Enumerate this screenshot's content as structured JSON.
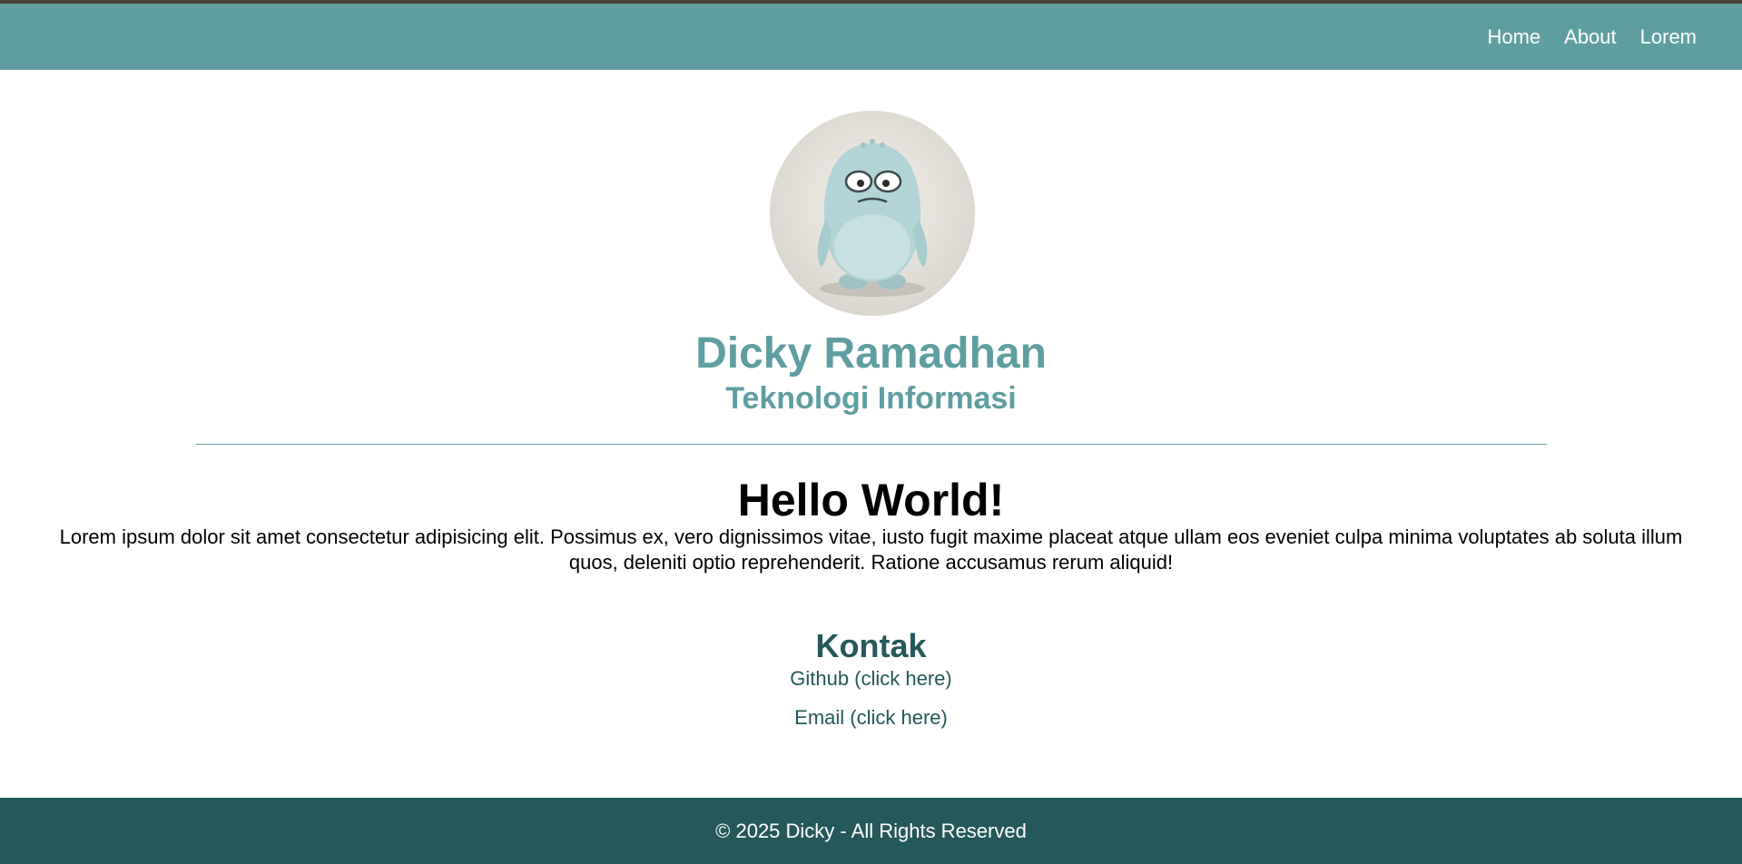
{
  "nav": {
    "links": [
      "Home",
      "About",
      "Lorem"
    ]
  },
  "profile": {
    "name": "Dicky Ramadhan",
    "major": "Teknologi Informasi"
  },
  "main": {
    "heading": "Hello World!",
    "paragraph": "Lorem ipsum dolor sit amet consectetur adipisicing elit. Possimus ex, vero dignissimos vitae, iusto fugit maxime placeat atque ullam eos eveniet culpa minima voluptates ab soluta illum quos, deleniti optio reprehenderit. Ratione accusamus rerum aliquid!"
  },
  "contact": {
    "title": "Kontak",
    "github": "Github (click here)",
    "email": "Email (click here)"
  },
  "footer": {
    "text": "© 2025 Dicky - All Rights Reserved"
  },
  "colors": {
    "primary": "#5f9ea0",
    "dark": "#24585a"
  }
}
